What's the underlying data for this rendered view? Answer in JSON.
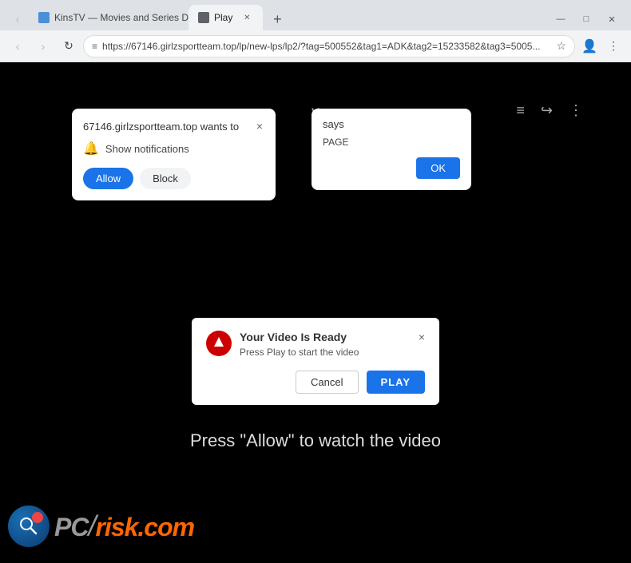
{
  "browser": {
    "tabs": [
      {
        "id": "tab1",
        "label": "KinsTV — Movies and Series D...",
        "active": false,
        "favicon": "K"
      },
      {
        "id": "tab2",
        "label": "Play",
        "active": true,
        "favicon": "P"
      }
    ],
    "new_tab_label": "+",
    "window_controls": {
      "minimize": "—",
      "maximize": "□",
      "close": "✕"
    },
    "nav": {
      "back": "‹",
      "forward": "›",
      "refresh": "↻",
      "address": "https://67146.girlzsportteam.top/lp/new-lps/lp2/?tag=500552&tag1=ADK&tag2=15233582&tag3=5005...",
      "secure_icon": "≡",
      "star": "☆"
    }
  },
  "notification_popup": {
    "title": "67146.girlzsportteam.top wants to",
    "close_label": "×",
    "bell_icon": "🔔",
    "permission_label": "Show notifications",
    "allow_label": "Allow",
    "block_label": "Block"
  },
  "site_says_popup": {
    "title": "says",
    "message": "PAGE",
    "ok_label": "OK"
  },
  "video_popup": {
    "title": "Your Video Is Ready",
    "subtitle": "Press Play to start the video",
    "close_label": "×",
    "cancel_label": "Cancel",
    "play_label": "PLAY"
  },
  "page": {
    "press_allow_text": "Press \"Allow\" to watch the video",
    "down_arrow": "∨",
    "icons": [
      "≡",
      "↪",
      "⋮"
    ]
  },
  "pcrisk": {
    "text_gray": "PC",
    "slash": "/",
    "text_orange": "risk.com"
  },
  "colors": {
    "accent_blue": "#1a73e8",
    "text_dark": "#202124",
    "bg_page": "#000000"
  }
}
